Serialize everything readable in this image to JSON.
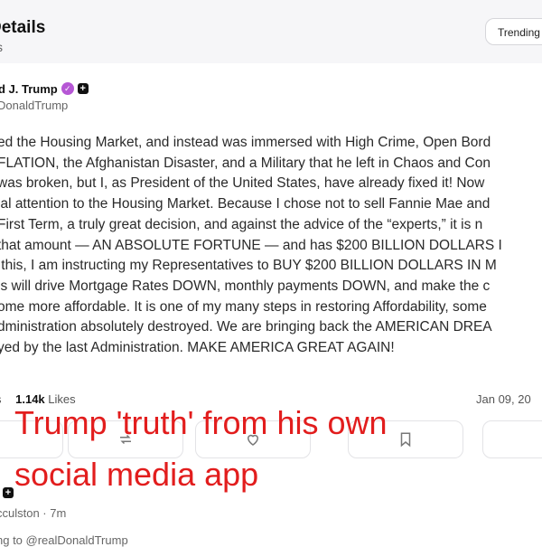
{
  "header": {
    "title": "Details",
    "subtitle": "s",
    "trending_label": "Trending"
  },
  "post": {
    "author_name": "d J. Trump",
    "author_handle": "DonaldTrump",
    "body": "ed the Housing Market, and instead was immersed with High Crime, Open Bord\nFLATION, the Afghanistan Disaster, and a Military that he left in Chaos and Con\nwas broken, but I, as President of the United States, have already fixed it! Now\nial attention to the Housing Market. Because I chose not to sell Fannie Mae and\nFirst Term, a truly great decision, and against the advice of the “experts,” it is n\nthat amount — AN ABSOLUTE FORTUNE — and has $200 BILLION DOLLARS I\n this, I am instructing my Representatives to BUY $200 BILLION DOLLARS IN M\nis will drive Mortgage Rates DOWN, monthly payments DOWN, and make the c\nome more affordable. It is one of my many steps in restoring Affordability, some\ndministration absolutely destroyed. We are bringing back the AMERICAN DREA\nyed by the last Administration. MAKE AMERICA GREAT AGAIN!",
    "stats_prefix": "s",
    "likes_count": "1.14k",
    "likes_label": "Likes",
    "date": "Jan 09, 20"
  },
  "actions": {
    "repost_icon": "repost-icon",
    "like_icon": "heart-icon",
    "bookmark_icon": "bookmark-icon"
  },
  "overlay": {
    "caption_line1": "Trump 'truth' from his own",
    "caption_line2": "social media app",
    "caption_color": "#e21d1d"
  },
  "reply": {
    "handle": "cculston · 7m",
    "replying_to": "ng to @realDonaldTrump"
  }
}
